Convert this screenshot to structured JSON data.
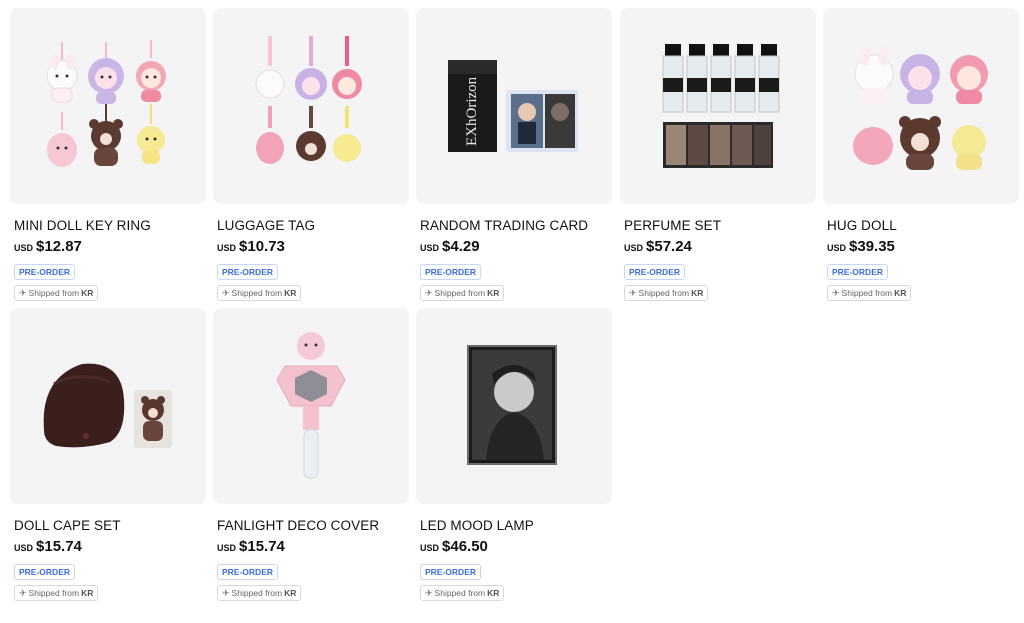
{
  "products": [
    {
      "name": "MINI DOLL KEY RING",
      "currency": "USD",
      "price": "$12.87",
      "badge": "PRE-ORDER",
      "ship_label": "Shipped from",
      "ship_origin": "KR",
      "image": "mini-doll-keyring"
    },
    {
      "name": "LUGGAGE TAG",
      "currency": "USD",
      "price": "$10.73",
      "badge": "PRE-ORDER",
      "ship_label": "Shipped from",
      "ship_origin": "KR",
      "image": "luggage-tag"
    },
    {
      "name": "RANDOM TRADING CARD",
      "currency": "USD",
      "price": "$4.29",
      "badge": "PRE-ORDER",
      "ship_label": "Shipped from",
      "ship_origin": "KR",
      "image": "trading-card",
      "image_text": "EXhOrizon"
    },
    {
      "name": "PERFUME SET",
      "currency": "USD",
      "price": "$57.24",
      "badge": "PRE-ORDER",
      "ship_label": "Shipped from",
      "ship_origin": "KR",
      "image": "perfume-set"
    },
    {
      "name": "HUG DOLL",
      "currency": "USD",
      "price": "$39.35",
      "badge": "PRE-ORDER",
      "ship_label": "Shipped from",
      "ship_origin": "KR",
      "image": "hug-doll"
    },
    {
      "name": "DOLL CAPE SET",
      "currency": "USD",
      "price": "$15.74",
      "badge": "PRE-ORDER",
      "ship_label": "Shipped from",
      "ship_origin": "KR",
      "image": "doll-cape-set"
    },
    {
      "name": "FANLIGHT DECO COVER",
      "currency": "USD",
      "price": "$15.74",
      "badge": "PRE-ORDER",
      "ship_label": "Shipped from",
      "ship_origin": "KR",
      "image": "fanlight-deco-cover"
    },
    {
      "name": "LED MOOD LAMP",
      "currency": "USD",
      "price": "$46.50",
      "badge": "PRE-ORDER",
      "ship_label": "Shipped from",
      "ship_origin": "KR",
      "image": "led-mood-lamp"
    }
  ],
  "colors": {
    "badge_blue": "#3e6fd8",
    "thumb_bg": "#f4f4f4"
  }
}
